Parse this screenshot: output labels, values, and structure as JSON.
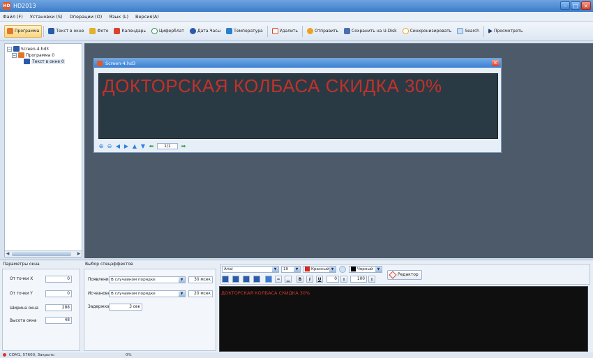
{
  "window": {
    "title": "HD2013",
    "app_icon": "HD"
  },
  "menu": [
    "Файл (F)",
    "Установки (S)",
    "Операции (O)",
    "Язык (L)",
    "Версия(A)"
  ],
  "toolbar": [
    {
      "label": "Программа",
      "icon": "program-icon",
      "color": "#e0762a"
    },
    {
      "label": "Текст в окне",
      "icon": "text-window-icon",
      "color": "#2a5aa8"
    },
    {
      "label": "Фото",
      "icon": "photo-icon",
      "color": "#e3b12c"
    },
    {
      "label": "Календарь",
      "icon": "calendar-icon",
      "color": "#d9432d"
    },
    {
      "label": "Циферблат",
      "icon": "clock-icon",
      "color": "#2e8c4a"
    },
    {
      "label": "Дата.Часы",
      "icon": "datetime-icon",
      "color": "#2a5aa8"
    },
    {
      "label": "Температура",
      "icon": "temperature-icon",
      "color": "#2a7fd0"
    },
    {
      "label": "Удалить",
      "icon": "delete-icon",
      "color": "#d9432d"
    },
    {
      "label": "Отправить",
      "icon": "send-icon",
      "color": "#f0a020"
    },
    {
      "label": "Сохранить на U-Disk",
      "icon": "save-udisk-icon",
      "color": "#4a6fb0"
    },
    {
      "label": "Синхронизировать",
      "icon": "sync-icon",
      "color": "#f0a020"
    },
    {
      "label": "Search",
      "icon": "search-icon",
      "color": "#6aa0d8"
    },
    {
      "label": "Просмотреть",
      "icon": "preview-icon",
      "color": "#1c3f73"
    }
  ],
  "tree": {
    "root": "Screen-4.hd3",
    "program": "Программа 0",
    "item": "Текст в окне 0"
  },
  "screen_window": {
    "title": "Screen-4.hd3",
    "led_text": "ДОКТОРСКАЯ КОЛБАСА СКИДКА 30%",
    "page": "1/1"
  },
  "window_params": {
    "heading": "Параметры окна",
    "x_label": "От точки X",
    "x_value": "0",
    "y_label": "От точки Y",
    "y_value": "0",
    "w_label": "Ширина окна",
    "w_value": "288",
    "h_label": "Высота окна",
    "h_value": "48"
  },
  "effects": {
    "heading": "Выбор спецэффектов",
    "appear_label": "Появление",
    "appear_value": "В случайном порядке",
    "appear_time": "30 мсек",
    "disappear_label": "Исчезновение",
    "disappear_value": "В случайном порядке",
    "disappear_time": "20 мсек",
    "delay_label": "Задержка",
    "delay_value": "3 сек"
  },
  "editor": {
    "font": "Arial",
    "size": "10",
    "text_color_label": "Красный",
    "text_color": "#d9231c",
    "bg_color_label": "Черный",
    "bg_color": "#000000",
    "spacing": "0",
    "scale": "100",
    "bold": "B",
    "italic": "I",
    "underline": "U",
    "editor_button": "Редактор"
  },
  "preview": {
    "text": "ДОКТОРСКАЯ КОЛБАСА СКИДКА 30%"
  },
  "status": {
    "port": "COM1, 57600, Закрыть",
    "percent": "0%"
  }
}
